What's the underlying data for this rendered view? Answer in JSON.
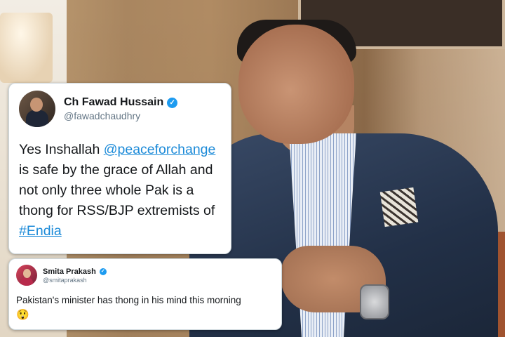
{
  "tweet_main": {
    "display_name": "Ch Fawad Hussain",
    "handle": "@fawadchaudhry",
    "text_part1": "Yes Inshallah ",
    "mention": "@peaceforchange",
    "text_part2": " is safe by the grace of Allah and not only three whole Pak is a thong for RSS/BJP extremists of ",
    "hashtag": "#Endia"
  },
  "tweet_second": {
    "display_name": "Smita Prakash",
    "handle": "@smitaprakash",
    "text": "Pakistan's minister has thong in his mind this morning",
    "emoji": "😲"
  },
  "icons": {
    "verified": "verified-badge-icon",
    "verified_glyph": "✓"
  },
  "colors": {
    "link": "#1b8ad8",
    "verified": "#1d9bf0"
  }
}
